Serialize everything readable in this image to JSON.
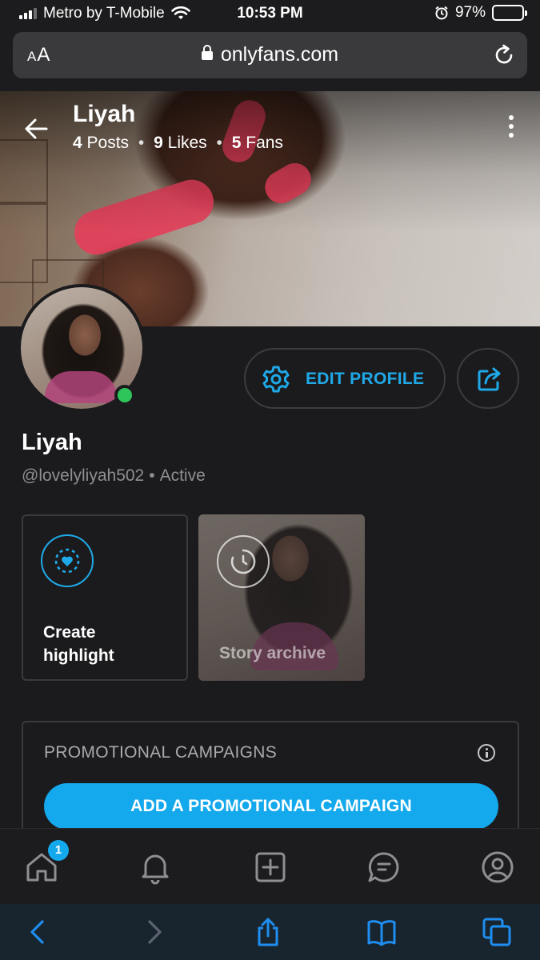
{
  "status_bar": {
    "carrier": "Metro by T-Mobile",
    "time": "10:53 PM",
    "battery": "97%",
    "battery_level": 0.97
  },
  "browser": {
    "aa_label": "AA",
    "domain": "onlyfans.com"
  },
  "profile": {
    "cover_name": "Liyah",
    "posts_count": "4",
    "posts_label": "Posts",
    "likes_count": "9",
    "likes_label": "Likes",
    "fans_count": "5",
    "fans_label": "Fans",
    "display_name": "Liyah",
    "handle": "@lovelyliyah502",
    "status": "Active",
    "online": true
  },
  "actions": {
    "edit_profile": "EDIT PROFILE"
  },
  "highlights": {
    "create_label": "Create highlight",
    "archive_label": "Story archive"
  },
  "promo": {
    "title": "PROMOTIONAL CAMPAIGNS",
    "cta": "ADD A PROMOTIONAL CAMPAIGN"
  },
  "app_nav": {
    "home_badge": "1",
    "items": [
      "home-icon",
      "bell-icon",
      "add-post-icon",
      "messages-icon",
      "profile-icon"
    ]
  },
  "safari_toolbar": {
    "items": [
      "back-icon",
      "forward-icon",
      "share-icon",
      "bookmarks-icon",
      "tabs-icon"
    ]
  },
  "colors": {
    "accent": "#14a8ec",
    "background": "#1b1b1d",
    "online": "#2ec65a"
  }
}
